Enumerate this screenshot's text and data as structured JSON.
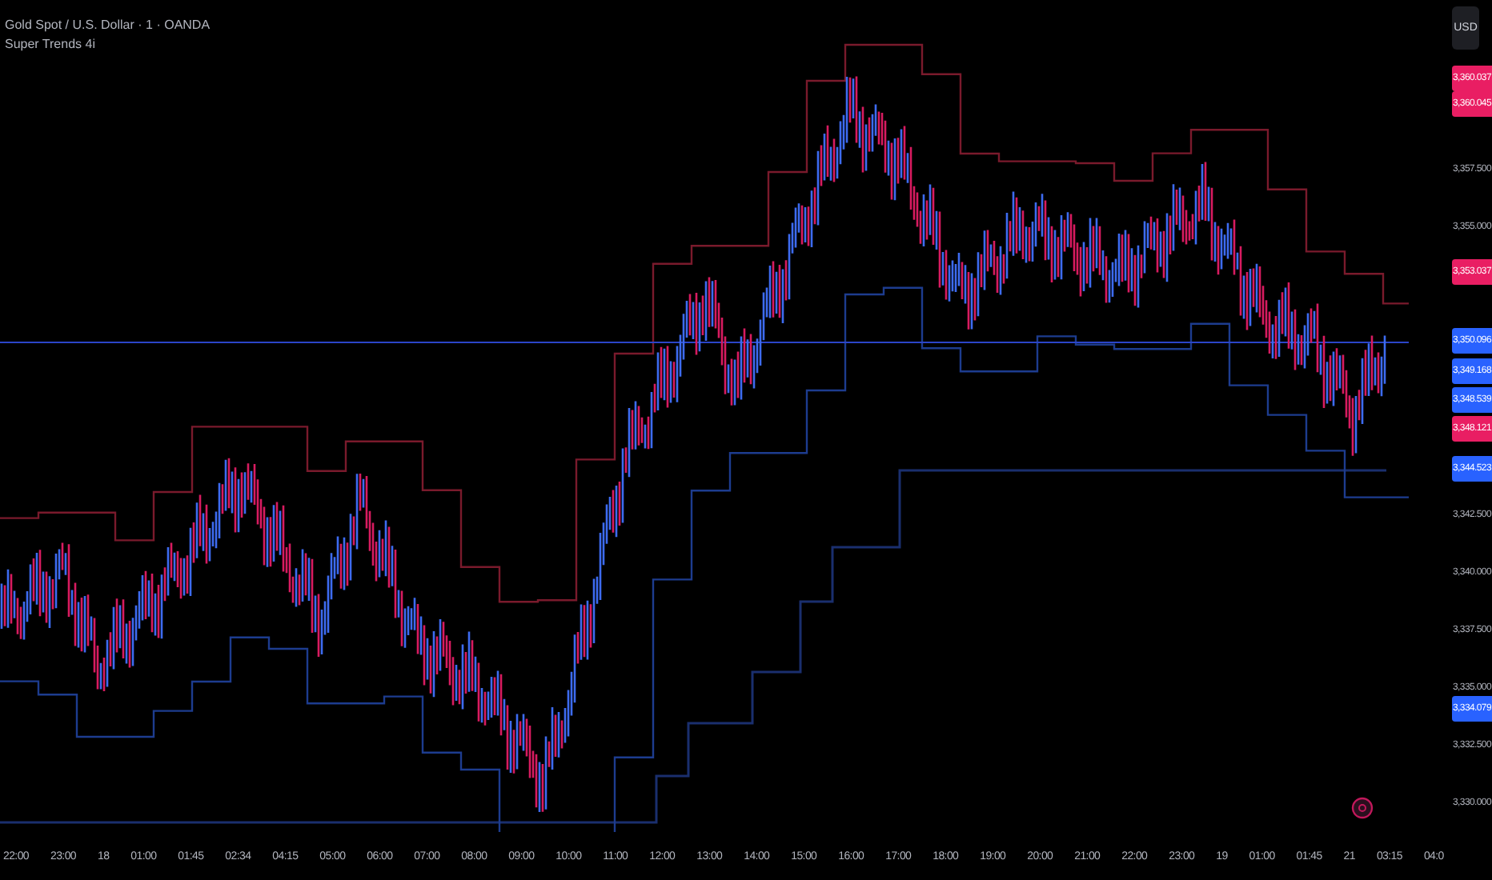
{
  "legend": {
    "symbol": "Gold Spot / U.S. Dollar · 1 · OANDA",
    "indicator": "Super Trends 4i"
  },
  "currency": "USD",
  "price_labels": [
    {
      "text": "3,360.037",
      "kind": "tag",
      "color": "#e91e63"
    },
    {
      "text": "3,360.045",
      "kind": "tag",
      "color": "#e91e63"
    },
    {
      "text": "3,357.500",
      "kind": "tick"
    },
    {
      "text": "3,355.000",
      "kind": "tick"
    },
    {
      "text": "3,353.037",
      "kind": "tag",
      "color": "#e91e63"
    },
    {
      "text": "3,350.096",
      "kind": "tag",
      "color": "#2962ff"
    },
    {
      "text": "3,349.168",
      "kind": "tag",
      "color": "#2962ff"
    },
    {
      "text": "3,348.539",
      "kind": "tag",
      "color": "#2962ff"
    },
    {
      "text": "3,348.121",
      "kind": "tag",
      "color": "#e91e63"
    },
    {
      "text": "3,344.523",
      "kind": "tag",
      "color": "#2962ff"
    },
    {
      "text": "3,342.500",
      "kind": "tick"
    },
    {
      "text": "3,340.000",
      "kind": "tick"
    },
    {
      "text": "3,337.500",
      "kind": "tick"
    },
    {
      "text": "3,335.000",
      "kind": "tick"
    },
    {
      "text": "3,334.079",
      "kind": "tag",
      "color": "#2962ff"
    },
    {
      "text": "3,332.500",
      "kind": "tick"
    },
    {
      "text": "3,330.000",
      "kind": "tick"
    }
  ],
  "time_labels": [
    "22:00",
    "23:00",
    "18",
    "01:00",
    "01:45",
    "02:34",
    "04:15",
    "05:00",
    "06:00",
    "07:00",
    "08:00",
    "09:00",
    "10:00",
    "11:00",
    "12:00",
    "13:00",
    "14:00",
    "15:00",
    "16:00",
    "17:00",
    "18:00",
    "19:00",
    "20:00",
    "21:00",
    "22:00",
    "23:00",
    "19",
    "01:00",
    "01:45",
    "21",
    "03:15",
    "04:0"
  ]
}
